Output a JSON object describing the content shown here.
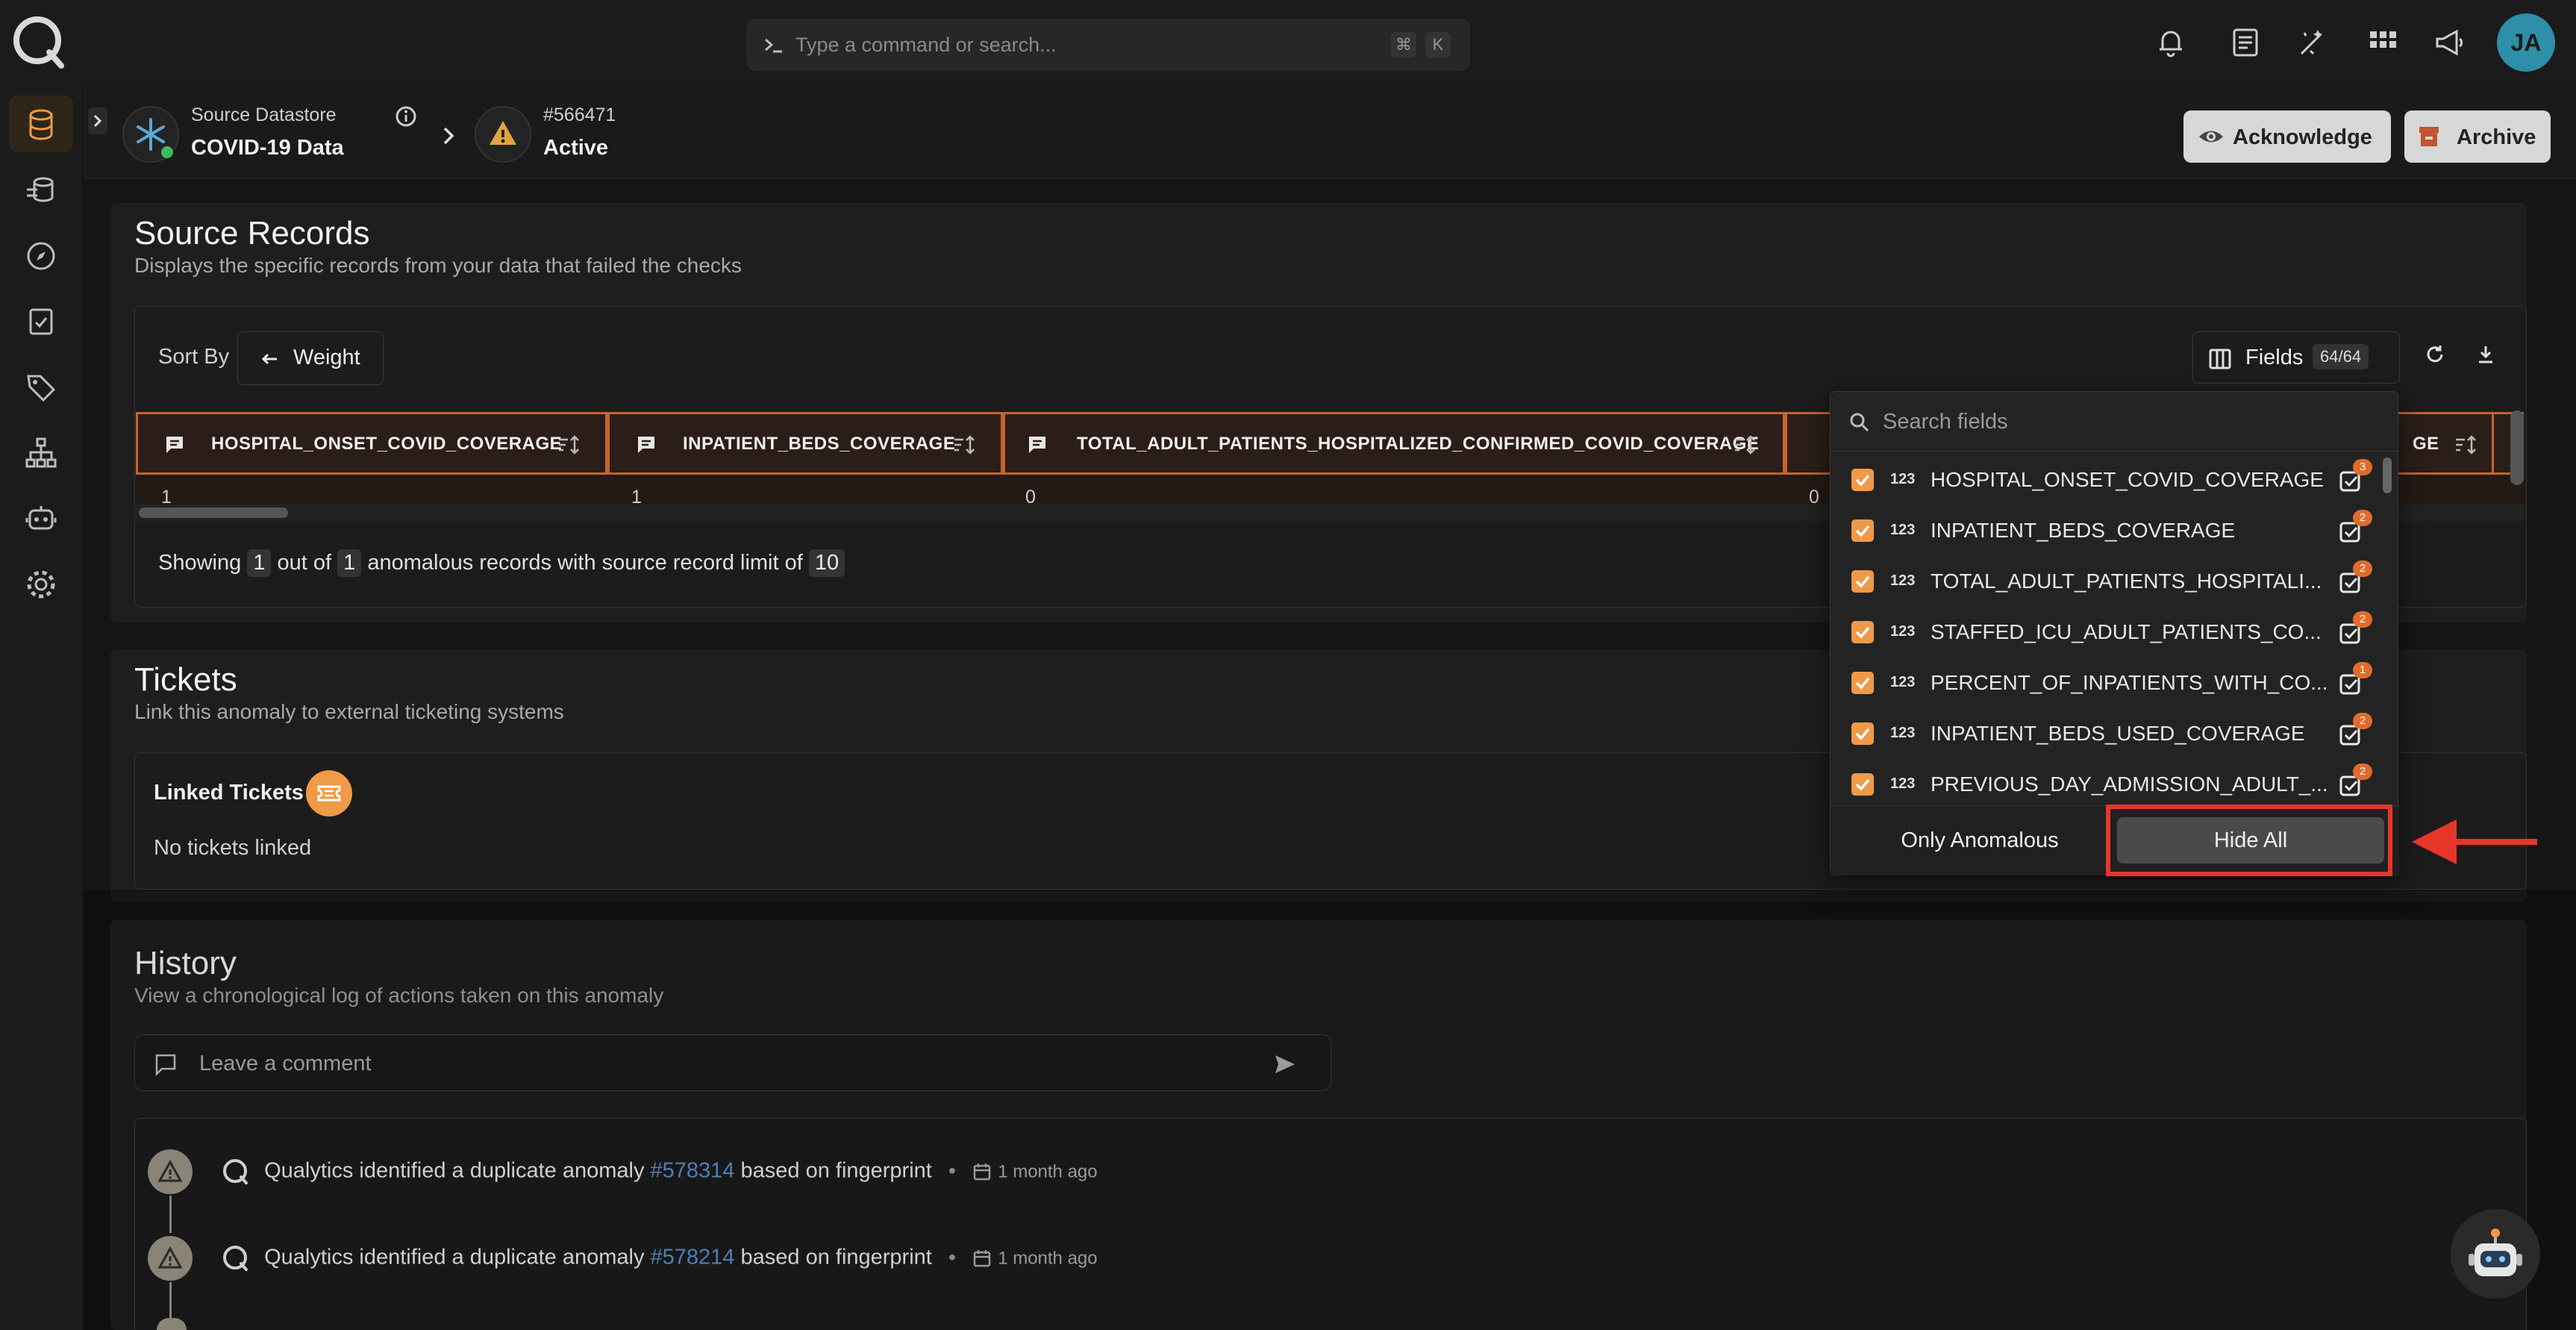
{
  "topbar": {
    "search_placeholder": "Type a command or search...",
    "shortcut_key1": "⌘",
    "shortcut_key2": "K",
    "avatar_initials": "JA"
  },
  "header": {
    "datastore_label": "Source Datastore",
    "datastore_name": "COVID-19 Data",
    "anomaly_id": "#566471",
    "anomaly_status": "Active",
    "acknowledge_label": "Acknowledge",
    "archive_label": "Archive"
  },
  "source_records": {
    "title": "Source Records",
    "subtitle": "Displays the specific records from your data that failed the checks",
    "sort_by_label": "Sort By",
    "sort_value": "Weight",
    "fields_label": "Fields",
    "fields_count": "64/64",
    "columns": [
      {
        "name": "HOSPITAL_ONSET_COVID_COVERAGE",
        "value": "1"
      },
      {
        "name": "INPATIENT_BEDS_COVERAGE",
        "value": "1"
      },
      {
        "name": "TOTAL_ADULT_PATIENTS_HOSPITALIZED_CONFIRMED_COVID_COVERAGE",
        "value": "0"
      },
      {
        "name": "",
        "value": "0"
      },
      {
        "name": "GE",
        "value": ""
      }
    ],
    "showing_prefix": "Showing",
    "showing_count": "1",
    "showing_mid": "out of",
    "showing_total": "1",
    "showing_suffix": "anomalous records with source record limit of",
    "showing_limit": "10"
  },
  "fields_dropdown": {
    "search_placeholder": "Search fields",
    "type_glyph": "123",
    "items": [
      {
        "name": "HOSPITAL_ONSET_COVID_COVERAGE",
        "badge": "3"
      },
      {
        "name": "INPATIENT_BEDS_COVERAGE",
        "badge": "2"
      },
      {
        "name": "TOTAL_ADULT_PATIENTS_HOSPITALI...",
        "badge": "2"
      },
      {
        "name": "STAFFED_ICU_ADULT_PATIENTS_CO...",
        "badge": "2"
      },
      {
        "name": "PERCENT_OF_INPATIENTS_WITH_CO...",
        "badge": "1"
      },
      {
        "name": "INPATIENT_BEDS_USED_COVERAGE",
        "badge": "2"
      },
      {
        "name": "PREVIOUS_DAY_ADMISSION_ADULT_...",
        "badge": "2"
      }
    ],
    "only_anomalous_label": "Only Anomalous",
    "hide_all_label": "Hide All"
  },
  "tickets": {
    "title": "Tickets",
    "subtitle": "Link this anomaly to external ticketing systems",
    "linked_label": "Linked Tickets",
    "empty_text": "No tickets linked"
  },
  "history": {
    "title": "History",
    "subtitle": "View a chronological log of actions taken on this anomaly",
    "comment_placeholder": "Leave a comment",
    "entries": [
      {
        "prefix": "Qualytics identified a duplicate anomaly",
        "link": "#578314",
        "suffix": "based on fingerprint",
        "time": "1 month ago"
      },
      {
        "prefix": "Qualytics identified a duplicate anomaly",
        "link": "#578214",
        "suffix": "based on fingerprint",
        "time": "1 month ago"
      }
    ]
  },
  "colors": {
    "accent_orange": "#ef9a47",
    "highlight_red": "#e8352a",
    "link_blue": "#4d7fb8",
    "background": "#151515"
  }
}
